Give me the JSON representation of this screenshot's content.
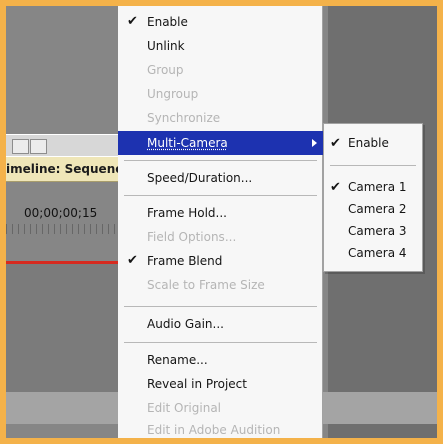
{
  "background_panel": {
    "timeline_tab_label": "imeline: Sequenc",
    "timecode": "00;00;00;15"
  },
  "context_menu": {
    "items": [
      {
        "label": "Enable",
        "checked": true,
        "enabled": true
      },
      {
        "label": "Unlink",
        "checked": false,
        "enabled": true
      },
      {
        "label": "Group",
        "checked": false,
        "enabled": false
      },
      {
        "label": "Ungroup",
        "checked": false,
        "enabled": false
      },
      {
        "label": "Synchronize",
        "checked": false,
        "enabled": false
      },
      {
        "label": "Multi-Camera",
        "checked": false,
        "enabled": true,
        "highlighted": true,
        "has_submenu": true
      },
      {
        "label": "Speed/Duration...",
        "checked": false,
        "enabled": true
      },
      {
        "label": "Frame Hold...",
        "checked": false,
        "enabled": true
      },
      {
        "label": "Field Options...",
        "checked": false,
        "enabled": false
      },
      {
        "label": "Frame Blend",
        "checked": true,
        "enabled": true
      },
      {
        "label": "Scale to Frame Size",
        "checked": false,
        "enabled": false
      },
      {
        "label": "Audio Gain...",
        "checked": false,
        "enabled": true
      },
      {
        "label": "Rename...",
        "checked": false,
        "enabled": true
      },
      {
        "label": "Reveal in Project",
        "checked": false,
        "enabled": true
      },
      {
        "label": "Edit Original",
        "checked": false,
        "enabled": false
      },
      {
        "label": "Edit in Adobe Audition",
        "checked": false,
        "enabled": false
      }
    ]
  },
  "submenu": {
    "items": [
      {
        "label": "Enable",
        "checked": true
      },
      {
        "label": "Camera 1",
        "checked": true
      },
      {
        "label": "Camera 2",
        "checked": false
      },
      {
        "label": "Camera 3",
        "checked": false
      },
      {
        "label": "Camera 4",
        "checked": false
      }
    ]
  },
  "colors": {
    "frame_orange": "#f4b24a",
    "highlight_blue": "#1d32b0",
    "timeline_red": "#d62a1f"
  }
}
